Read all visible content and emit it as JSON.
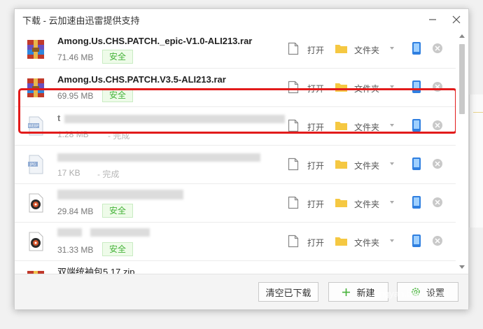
{
  "window": {
    "title": "下载 - 云加速由迅雷提供支持"
  },
  "actions": {
    "open_label": "打开",
    "folder_label": "文件夹"
  },
  "downloads": [
    {
      "name": "Among.Us.CHS.PATCH._epic-V1.0-ALI213.rar",
      "size": "71.46 MB",
      "badge": "安全",
      "icon": "rar-archive-icon"
    },
    {
      "name": "Among.Us.CHS.PATCH.V3.5-ALI213.rar",
      "size": "69.95 MB",
      "badge": "安全",
      "icon": "rar-archive-icon",
      "highlighted": true
    },
    {
      "name": "t",
      "size": "1.28 MB",
      "status": "- 完成",
      "icon": "webp-file-icon"
    },
    {
      "name": "",
      "size": "17 KB",
      "status": "- 完成",
      "icon": "jpg-file-icon"
    },
    {
      "name": "",
      "size": "29.84 MB",
      "badge": "安全",
      "icon": "media-file-icon"
    },
    {
      "name": "",
      "size": "31.33 MB",
      "badge": "安全",
      "icon": "media-file-icon"
    },
    {
      "name": "双端统袖包5.17.zip",
      "icon": "zip-archive-icon"
    }
  ],
  "footer": {
    "clear_label": "清空已下载",
    "new_label": "新建",
    "settings_label": "设置"
  },
  "watermark": {
    "text": "jingyan.baidu.com"
  },
  "colors": {
    "safe_green": "#46b33a",
    "highlight_red": "#e21b1b",
    "folder_yellow": "#f5c842",
    "phone_blue": "#2f7fe0"
  }
}
